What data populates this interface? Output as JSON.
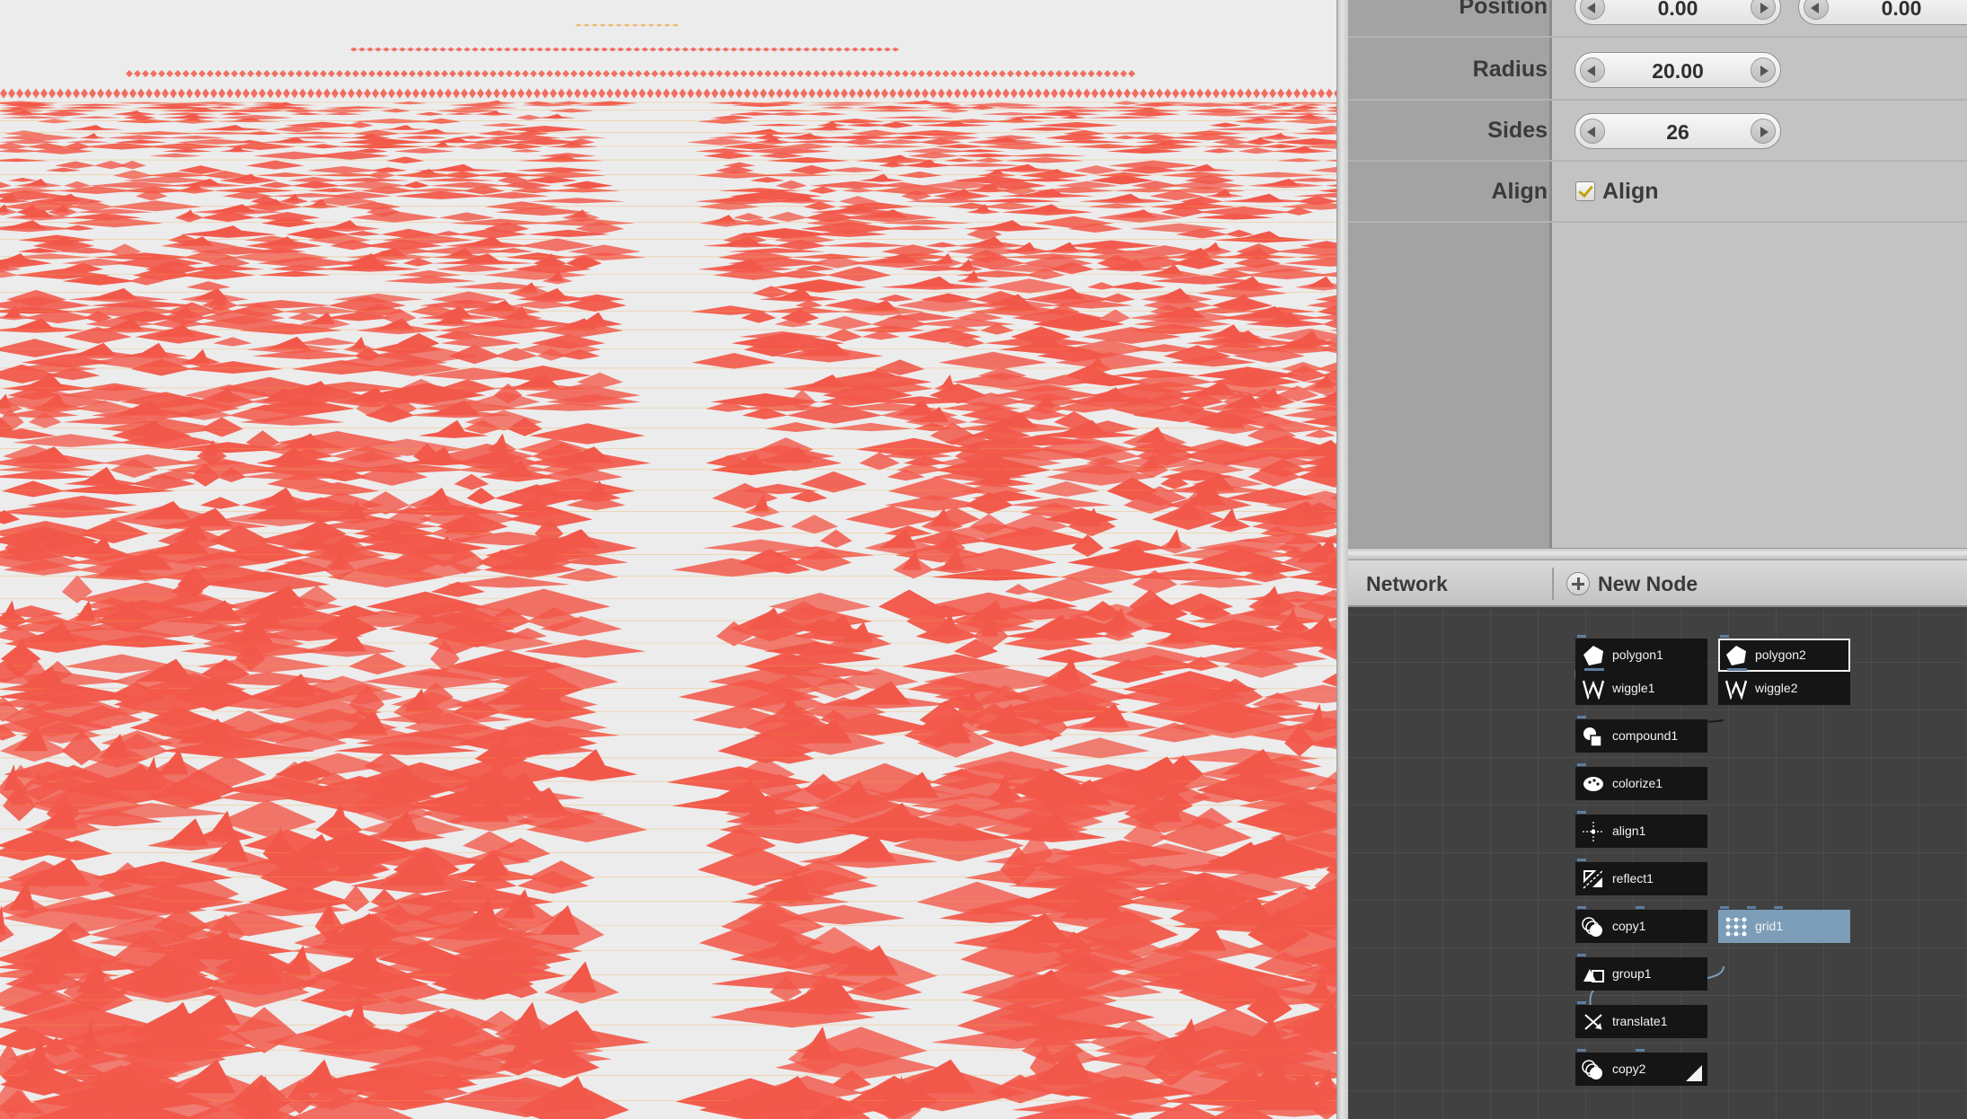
{
  "parameters": {
    "position": {
      "label": "Position",
      "x": "0.00",
      "y": "0.00"
    },
    "radius": {
      "label": "Radius",
      "value": "20.00"
    },
    "sides": {
      "label": "Sides",
      "value": "26"
    },
    "align": {
      "label": "Align",
      "checkbox_label": "Align",
      "checked": true
    }
  },
  "network": {
    "title": "Network",
    "new_node_label": "New Node",
    "nodes": [
      {
        "name": "polygon1",
        "icon": "polygon-icon"
      },
      {
        "name": "polygon2",
        "icon": "polygon-icon",
        "selected": true
      },
      {
        "name": "wiggle1",
        "icon": "wiggle-icon"
      },
      {
        "name": "wiggle2",
        "icon": "wiggle-icon"
      },
      {
        "name": "compound1",
        "icon": "compound-icon"
      },
      {
        "name": "colorize1",
        "icon": "colorize-icon"
      },
      {
        "name": "align1",
        "icon": "align-icon"
      },
      {
        "name": "reflect1",
        "icon": "reflect-icon"
      },
      {
        "name": "copy1",
        "icon": "copy-icon"
      },
      {
        "name": "grid1",
        "icon": "grid-icon"
      },
      {
        "name": "group1",
        "icon": "group-icon"
      },
      {
        "name": "translate1",
        "icon": "translate-icon"
      },
      {
        "name": "copy2",
        "icon": "copy-icon",
        "rendered": true
      }
    ]
  },
  "colors": {
    "viewer_background": "#ececec",
    "shape_fill": "#f2584a",
    "shape_outline": "#f0a640",
    "network_background": "#414141",
    "selected_node_highlight": "#7b9db8"
  }
}
